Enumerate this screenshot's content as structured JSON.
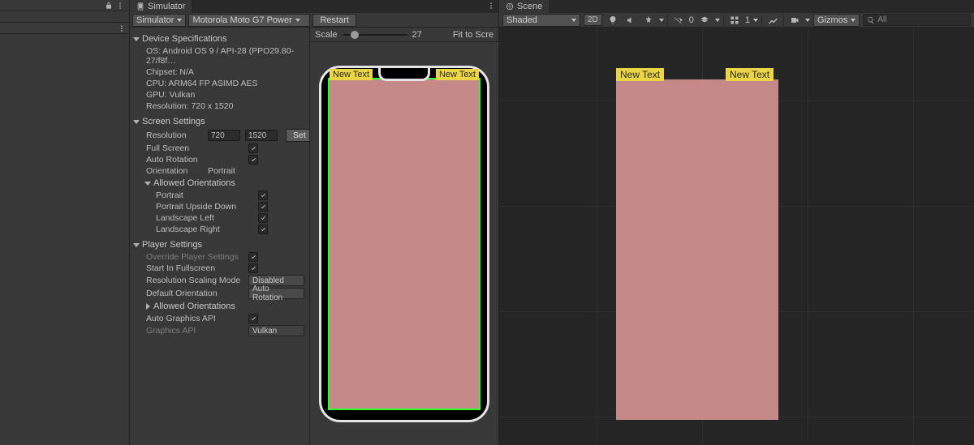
{
  "simulator": {
    "tab": "Simulator",
    "mode": "Simulator",
    "device": "Motorola Moto G7 Power",
    "restart": "Restart",
    "scale_label": "Scale",
    "scale_value": "27",
    "fit": "Fit to Scre"
  },
  "device_specs": {
    "title": "Device Specifications",
    "os": "OS: Android OS 9 / API-28 (PPO29.80-27/f8f…",
    "chipset": "Chipset: N/A",
    "cpu": "CPU: ARM64 FP ASIMD AES",
    "gpu": "GPU: Vulkan",
    "resolution": "Resolution: 720 x 1520"
  },
  "screen_settings": {
    "title": "Screen Settings",
    "resolution_label": "Resolution",
    "res_w": "720",
    "res_h": "1520",
    "set": "Set",
    "full_screen": "Full Screen",
    "auto_rotation": "Auto Rotation",
    "orientation_label": "Orientation",
    "orientation_value": "Portrait",
    "allowed_title": "Allowed Orientations",
    "portrait": "Portrait",
    "portrait_upside": "Portrait Upside Down",
    "landscape_left": "Landscape Left",
    "landscape_right": "Landscape Right"
  },
  "player_settings": {
    "title": "Player Settings",
    "override": "Override Player Settings",
    "start_fullscreen": "Start In Fullscreen",
    "scaling_label": "Resolution Scaling Mode",
    "scaling_value": "Disabled",
    "default_orient_label": "Default Orientation",
    "default_orient_value": "Auto Rotation",
    "allowed_title": "Allowed Orientations",
    "auto_gfx": "Auto Graphics API",
    "gfx_api_label": "Graphics API",
    "gfx_api_value": "Vulkan"
  },
  "sim_preview": {
    "tag_left": "New Text",
    "tag_right": "New Text"
  },
  "scene": {
    "tab": "Scene",
    "shaded": "Shaded",
    "btn_2d": "2D",
    "hidden_count": "0",
    "grid_num": "1",
    "gizmos": "Gizmos",
    "search_placeholder": "All",
    "tag_left": "New Text",
    "tag_right": "New Text"
  }
}
